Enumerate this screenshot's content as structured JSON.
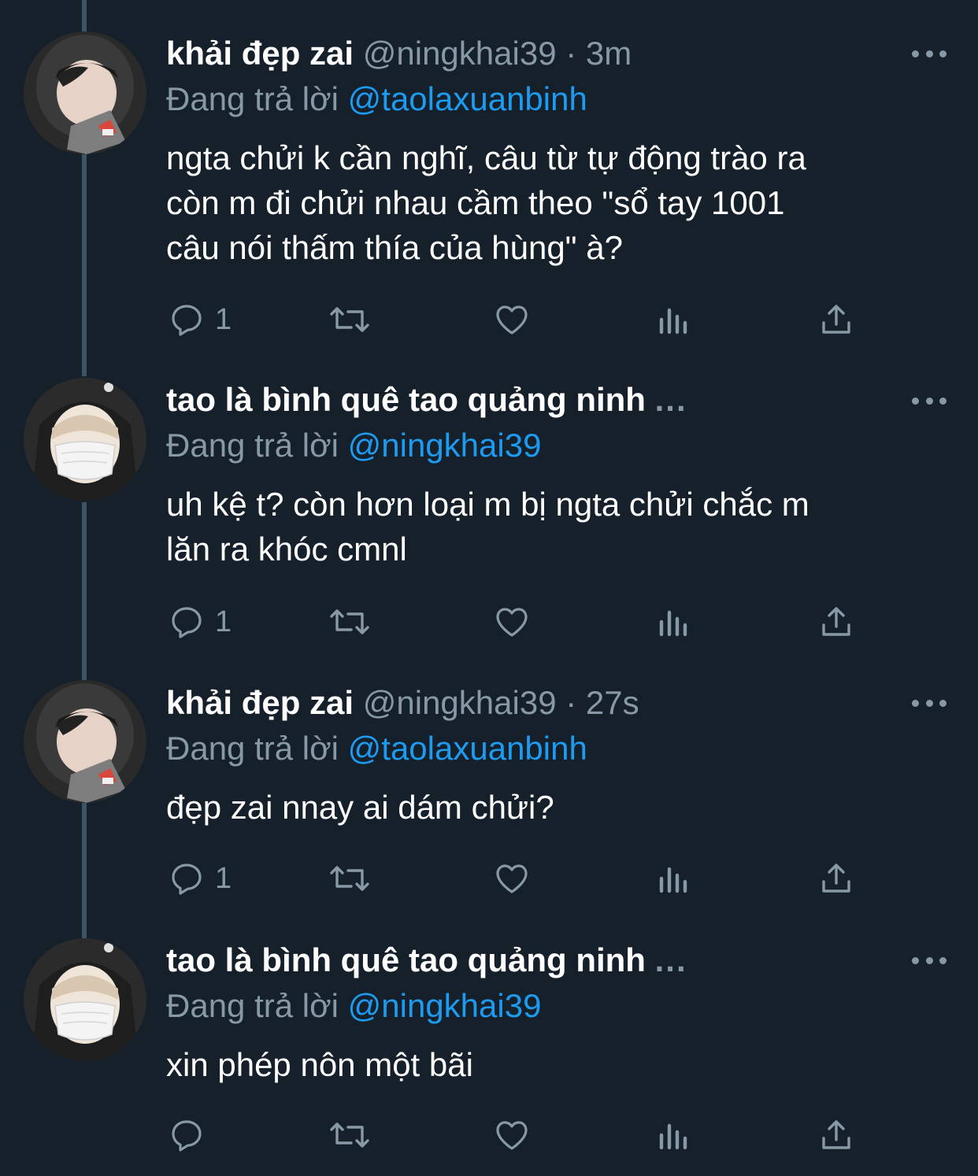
{
  "colors": {
    "background": "#15202b",
    "secondary_text": "#8899a6",
    "mention": "#1d9bf0",
    "thread_line": "#3d5466"
  },
  "tweets": [
    {
      "display_name": "khải đẹp zai",
      "handle": "@ningkhai39",
      "separator": "·",
      "time": "3m",
      "name_truncated": "",
      "replying_label": "Đang trả lời",
      "replying_to": "@taolaxuanbinh",
      "text": "ngta chửi k cần nghĩ, câu từ tự động trào ra\ncòn m đi chửi nhau cầm theo \"sổ tay 1001\ncâu nói thấm thía của hùng\" à?",
      "reply_count": "1",
      "avatar_icon": "avatar-hooded-boy"
    },
    {
      "display_name": "tao là bình quê tao quảng ninh",
      "handle": "",
      "separator": "",
      "time": "",
      "name_truncated": "...",
      "replying_label": "Đang trả lời",
      "replying_to": "@ningkhai39",
      "text": "uh kệ t? còn hơn loại m bị ngta chửi chắc m\nlăn ra khóc cmnl",
      "reply_count": "1",
      "avatar_icon": "avatar-masked-boy"
    },
    {
      "display_name": "khải đẹp zai",
      "handle": "@ningkhai39",
      "separator": "·",
      "time": "27s",
      "name_truncated": "",
      "replying_label": "Đang trả lời",
      "replying_to": "@taolaxuanbinh",
      "text": "đẹp zai nnay ai dám chửi?",
      "reply_count": "1",
      "avatar_icon": "avatar-hooded-boy"
    },
    {
      "display_name": "tao là bình quê tao quảng ninh",
      "handle": "",
      "separator": "",
      "time": "",
      "name_truncated": "...",
      "replying_label": "Đang trả lời",
      "replying_to": "@ningkhai39",
      "text": "xin phép nôn một bãi",
      "reply_count": "",
      "avatar_icon": "avatar-masked-boy"
    }
  ]
}
